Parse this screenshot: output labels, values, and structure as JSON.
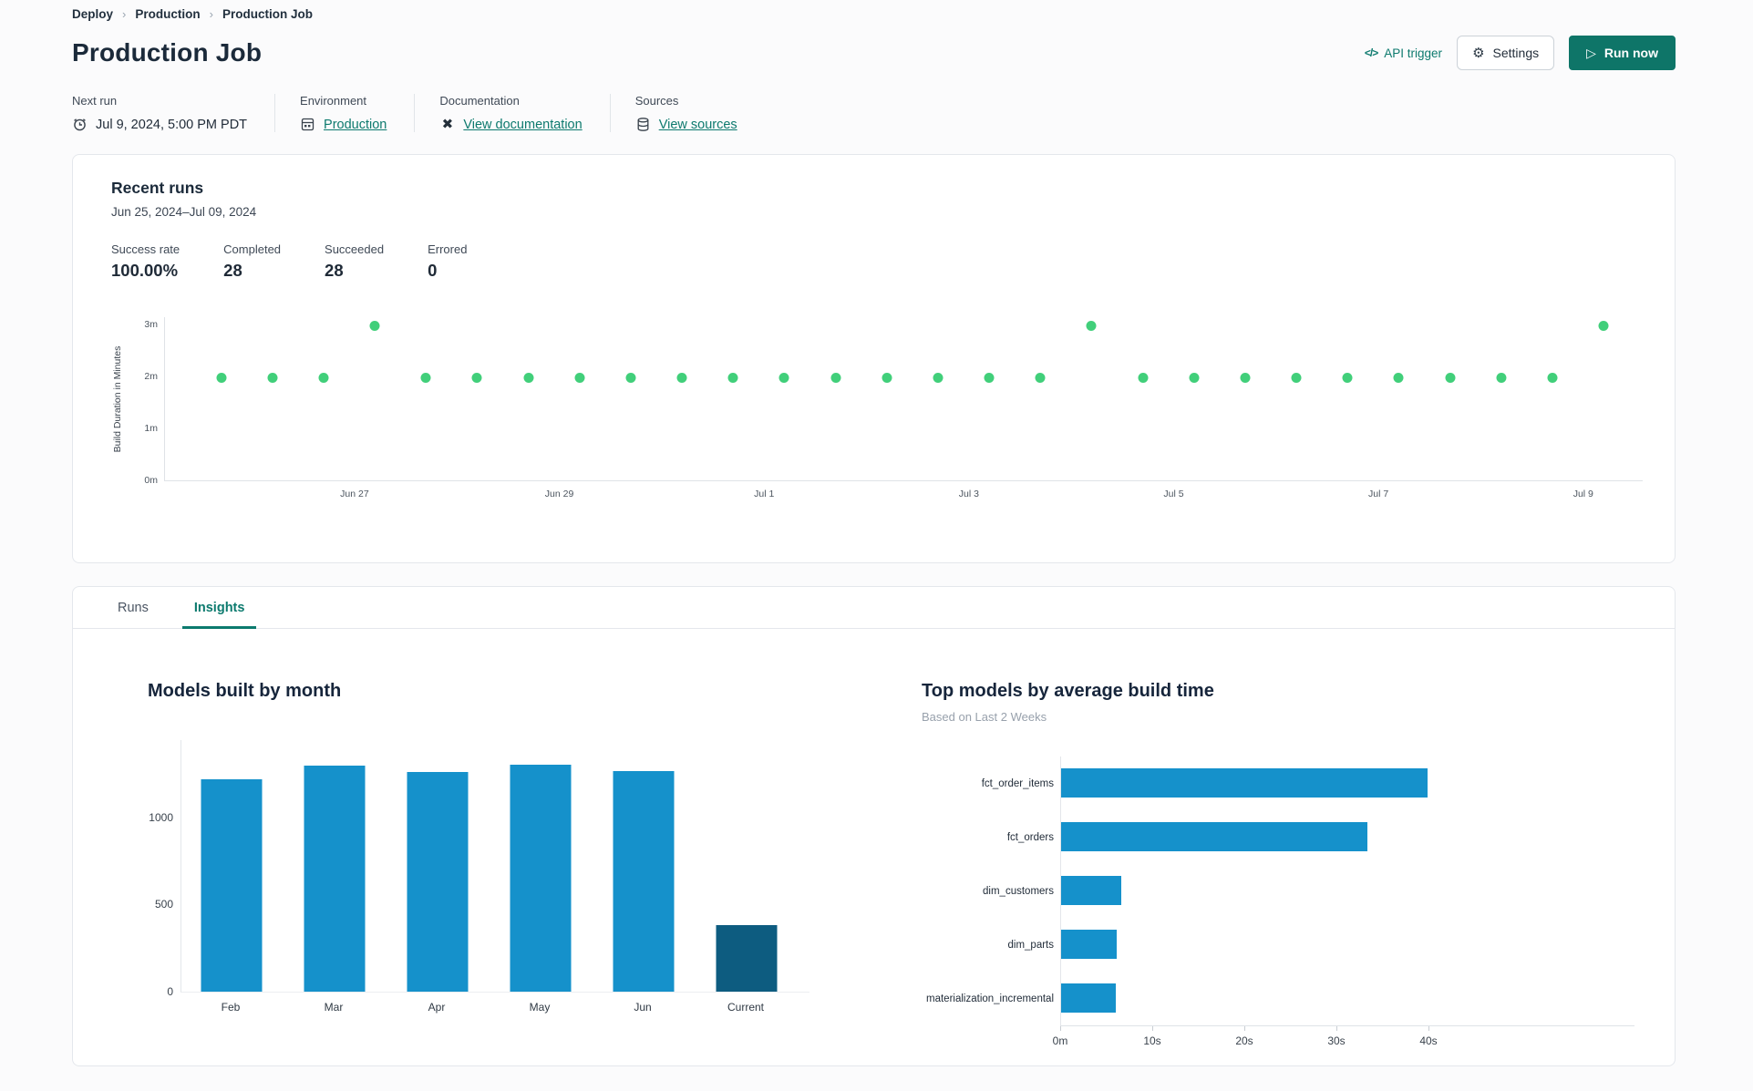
{
  "breadcrumb": {
    "separator": "›",
    "items": [
      "Deploy",
      "Production",
      "Production Job"
    ]
  },
  "header": {
    "title": "Production Job",
    "actions": {
      "api_trigger_label": "API trigger",
      "api_trigger_icon": "</>",
      "settings_label": "Settings",
      "run_now_label": "Run now",
      "play_glyph": "▷",
      "gear_glyph": "⚙"
    }
  },
  "meta": {
    "columns": [
      {
        "label": "Next run",
        "value": "Jul 9, 2024, 5:00 PM PDT",
        "icon": "clock-icon",
        "is_link": false
      },
      {
        "label": "Environment",
        "value": "Production",
        "icon": "environment-icon",
        "is_link": true
      },
      {
        "label": "Documentation",
        "value": "View documentation",
        "icon": "dbt-docs-icon",
        "is_link": true
      },
      {
        "label": "Sources",
        "value": "View sources",
        "icon": "database-icon",
        "is_link": true
      }
    ],
    "docs_icon_glyph": "✖"
  },
  "recent_runs": {
    "title": "Recent runs",
    "date_range": "Jun 25, 2024–Jul 09, 2024",
    "stats": [
      {
        "label": "Success rate",
        "value": "100.00%"
      },
      {
        "label": "Completed",
        "value": "28"
      },
      {
        "label": "Succeeded",
        "value": "28"
      },
      {
        "label": "Errored",
        "value": "0"
      }
    ]
  },
  "tabs": [
    {
      "label": "Runs",
      "active": false
    },
    {
      "label": "Insights",
      "active": true
    }
  ],
  "colors": {
    "accent_teal": "#0d7a6e",
    "run_button_bg": "#0e7568",
    "dot_green": "#41cf7a",
    "bar_blue": "#1591cb",
    "bar_dark_blue": "#0d5c80",
    "card_border": "#e4e7ec",
    "text_dark": "#1f2a37",
    "text_gray": "#3f4956"
  },
  "chart_data": [
    {
      "type": "scatter",
      "title": "Recent runs — build duration per run",
      "ylabel": "Build Duration in Minutes",
      "ylim": [
        0,
        3.15
      ],
      "y_ticks": [
        {
          "value": 0,
          "label": "0m"
        },
        {
          "value": 1,
          "label": "1m"
        },
        {
          "value": 2,
          "label": "2m"
        },
        {
          "value": 3,
          "label": "3m"
        }
      ],
      "x_ticks": [
        {
          "label": "Jun 27",
          "pct": 12.88
        },
        {
          "label": "Jun 29",
          "pct": 26.73
        },
        {
          "label": "Jul 1",
          "pct": 40.58
        },
        {
          "label": "Jul 3",
          "pct": 54.43
        },
        {
          "label": "Jul 5",
          "pct": 68.28
        },
        {
          "label": "Jul 7",
          "pct": 82.13
        },
        {
          "label": "Jul 9",
          "pct": 95.98
        }
      ],
      "x_start_pct": 3.8,
      "x_step_pct": 3.465,
      "point_color": "#41cf7a",
      "durations_minutes": [
        1.97,
        1.97,
        1.97,
        2.97,
        1.97,
        1.97,
        1.97,
        1.97,
        1.97,
        1.97,
        1.97,
        1.97,
        1.97,
        1.97,
        1.97,
        1.97,
        1.97,
        2.97,
        1.97,
        1.97,
        1.97,
        1.97,
        1.97,
        1.97,
        1.97,
        1.97,
        1.97,
        2.97
      ],
      "grid": false,
      "legend": "none"
    },
    {
      "type": "bar",
      "title": "Models built by month",
      "categories": [
        "Feb",
        "Mar",
        "Apr",
        "May",
        "Jun",
        "Current"
      ],
      "values": [
        1220,
        1300,
        1260,
        1305,
        1265,
        380
      ],
      "bar_colors": [
        "#1591cb",
        "#1591cb",
        "#1591cb",
        "#1591cb",
        "#1591cb",
        "#0d5c80"
      ],
      "y_ticks": [
        0,
        500,
        1000
      ],
      "ylim": [
        0,
        1450
      ],
      "xlabel": "",
      "ylabel": "",
      "grid": false,
      "legend": "none"
    },
    {
      "type": "bar-horizontal",
      "title": "Top models by average build time",
      "subtitle": "Based on Last 2 Weeks",
      "categories": [
        "fct_order_items",
        "fct_orders",
        "dim_customers",
        "dim_parts",
        "materialization_incremental"
      ],
      "values_seconds": [
        39.8,
        33.3,
        6.5,
        6.0,
        5.9
      ],
      "x_ticks": [
        {
          "value": 0,
          "label": "0m"
        },
        {
          "value": 10,
          "label": "10s"
        },
        {
          "value": 20,
          "label": "20s"
        },
        {
          "value": 30,
          "label": "30s"
        },
        {
          "value": 40,
          "label": "40s"
        }
      ],
      "xlim_seconds": [
        0,
        44
      ],
      "bar_color": "#1591cb",
      "grid": false,
      "legend": "none"
    }
  ]
}
